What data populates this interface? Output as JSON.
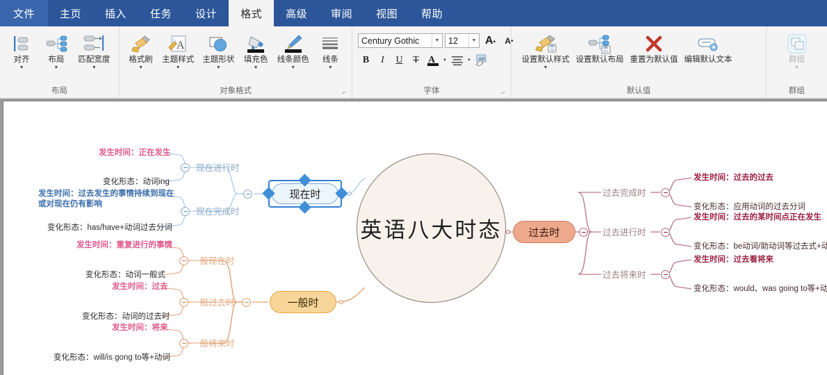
{
  "menubar": {
    "items": [
      {
        "label": "文件",
        "state": "file"
      },
      {
        "label": "主页",
        "state": "normal"
      },
      {
        "label": "插入",
        "state": "normal"
      },
      {
        "label": "任务",
        "state": "normal"
      },
      {
        "label": "设计",
        "state": "normal"
      },
      {
        "label": "格式",
        "state": "active"
      },
      {
        "label": "高级",
        "state": "normal"
      },
      {
        "label": "审阅",
        "state": "normal"
      },
      {
        "label": "视图",
        "state": "normal"
      },
      {
        "label": "帮助",
        "state": "normal"
      }
    ]
  },
  "ribbon": {
    "groups": [
      {
        "title": "布局",
        "dialog_launcher": false,
        "buttons": [
          {
            "label": "对齐",
            "icon": "align-icon",
            "caret": true
          },
          {
            "label": "布局",
            "icon": "layout-icon",
            "caret": true
          },
          {
            "label": "匹配宽度",
            "icon": "match-width-icon",
            "caret": true
          }
        ]
      },
      {
        "title": "对象格式",
        "dialog_launcher": true,
        "buttons": [
          {
            "label": "格式刷",
            "icon": "format-painter-icon",
            "caret": true
          },
          {
            "label": "主题样式",
            "icon": "theme-style-icon",
            "caret": true
          },
          {
            "label": "主题形状",
            "icon": "theme-shape-icon",
            "caret": true
          },
          {
            "label": "填充色",
            "icon": "fill-color-icon",
            "caret": true
          },
          {
            "label": "线条颜色",
            "icon": "line-color-icon",
            "caret": true
          },
          {
            "label": "线条",
            "icon": "line-style-icon",
            "caret": true
          }
        ]
      },
      {
        "title": "字体",
        "dialog_launcher": true,
        "font_name": "Century Gothic",
        "font_size": "12",
        "grow_font_label": "A",
        "shrink_font_label": "A",
        "bold_label": "B",
        "italic_label": "I",
        "underline_label": "U",
        "strike_label": "T",
        "text_color_label": "A",
        "align_label": "≡",
        "clear_format_label": "⌫"
      },
      {
        "title": "默认值",
        "dialog_launcher": false,
        "buttons": [
          {
            "label": "设置默认样式",
            "icon": "set-default-style-icon",
            "caret": true
          },
          {
            "label": "设置默认布局",
            "icon": "set-default-layout-icon",
            "caret": false
          },
          {
            "label": "重置为默认值",
            "icon": "reset-default-icon",
            "caret": false
          },
          {
            "label": "编辑默认文本",
            "icon": "edit-default-text-icon",
            "caret": false
          }
        ]
      },
      {
        "title": "群组",
        "dialog_launcher": false,
        "buttons": [
          {
            "label": "群组",
            "icon": "group-icon",
            "caret": true,
            "disabled": true
          }
        ]
      }
    ]
  },
  "mindmap": {
    "central": "英语八大时态",
    "topics": [
      {
        "id": "present",
        "label": "现在时",
        "selected": true
      },
      {
        "id": "past",
        "label": "过去时",
        "selected": false
      },
      {
        "id": "simple",
        "label": "一般时",
        "selected": false
      }
    ],
    "subtopics": [
      {
        "id": "present-continuous",
        "label": "现在进行时"
      },
      {
        "id": "present-perfect",
        "label": "现在完成时"
      },
      {
        "id": "simple-present",
        "label": "一般现在时"
      },
      {
        "id": "simple-past",
        "label": "一般过去时"
      },
      {
        "id": "simple-future",
        "label": "一般将来时"
      },
      {
        "id": "past-perfect",
        "label": "过去完成时"
      },
      {
        "id": "past-continuous",
        "label": "过去进行时"
      },
      {
        "id": "past-future",
        "label": "过去将来时"
      }
    ],
    "details": {
      "present_continuous_time": "发生时间：正在发生",
      "present_continuous_form": "变化形态：动词ing",
      "present_perfect_time_l1": "发生时间：过去发生的事情持续到现在",
      "present_perfect_time_l2": "或对现在仍有影响",
      "present_perfect_form": "变化形态：has/have+动词过去分词",
      "simple_present_time": "发生时间：重复进行的事情",
      "simple_present_form": "变化形态：动词一般式",
      "simple_past_time": "发生时间：过去",
      "simple_past_form": "变化形态：动词的过去时",
      "simple_future_time": "发生时间：将来",
      "simple_future_form": "变化形态：will/is gong to等+动词",
      "past_perfect_time": "发生时间：过去的过去",
      "past_perfect_form": "变化形态：应用动词的过去分词",
      "past_continuous_time": "发生时间：过去的某时间点正在发生",
      "past_continuous_form": "变化形态：be动词/助动词等过去式+动词ing",
      "past_future_time": "发生时间：过去看将来",
      "past_future_form": "变化形态：would、was going to等+动词"
    }
  },
  "colors": {
    "menubar_bg": "#2c5699",
    "ribbon_bg": "#f4f4f4",
    "present_fill": "#eef6fd",
    "past_fill": "#eda98c",
    "simple_fill": "#f8d69a",
    "central_fill": "#f7f3ec",
    "selection": "#2e7fd4",
    "pink_text": "#e05a8a",
    "maroon_text": "#9c2144",
    "purple_text": "#6f5bb5",
    "blue_text": "#3d6fae"
  }
}
